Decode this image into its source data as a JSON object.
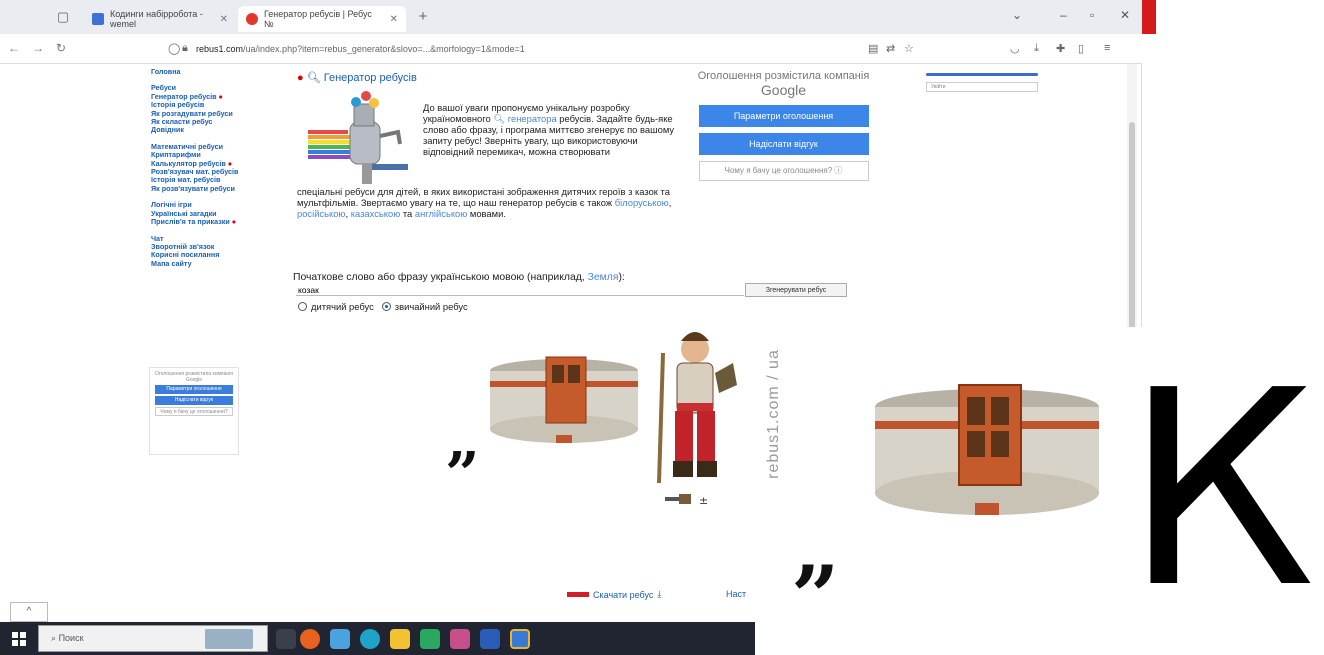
{
  "browser": {
    "tabs": [
      {
        "title": "Кодинги набірробота - wemel",
        "active": false
      },
      {
        "title": "Генератор ребусів | Ребус №",
        "active": true
      }
    ],
    "new_tab": "+",
    "url_domain": "rebus1.com",
    "url_rest": "/ua/index.php?item=rebus_generator&slovo=...&morfology=1&mode=1"
  },
  "sidebar": {
    "groups": [
      [
        "Головна"
      ],
      [
        "Ребуси",
        "Генератор ребусів",
        "Історія ребусів",
        "Як розгадувати ребуси",
        "Як скласти ребус",
        "Довідник"
      ],
      [
        "Математичні ребуси",
        "Криптарифми",
        "Калькулятор ребусів",
        "Розв'язувач мат. ребусів",
        "Історія мат. ребусів",
        "Як розв'язувати ребуси"
      ],
      [
        "Логічні ігри",
        "Українські загадки",
        "Прислів'я та приказки"
      ],
      [
        "Чат",
        "Зворотній зв'язок",
        "Корисні посилання",
        "Мапа сайту"
      ]
    ],
    "mini_ad": {
      "text": "Оголошення розмістила компанія Google",
      "btn1": "Параметри оголошення",
      "btn2": "Надіслати відгук",
      "why": "Чому я бачу це оголошення?"
    }
  },
  "main": {
    "title": "Генератор ребусів",
    "intro_part1": "До вашої уваги пропонуємо унікальну розробку україномовного",
    "intro_link": "генератора",
    "intro_part2": "ребусів. Задайте будь-яке слово або фразу, і програма миттєво згенерує по вашому запиту ребус! Зверніть увагу, що використовуючи відповідний перемикач, можна створювати",
    "intro_part3": "спеціальні ребуси для дітей, в яких використані зображення дитячих героїв з казок та мультфільмів. Звертаємо увагу на те, що наш генератор ребусів є також",
    "lang1": "білоруською",
    "lang2": "російською",
    "lang3": "казахською",
    "lang_and": "та",
    "lang4": "англійською",
    "intro_end": "мовами.",
    "prompt_text": "Початкове слово або фразу українською мовою (наприклад,",
    "prompt_example": "Земля",
    "prompt_close": "):",
    "input_value": "козак",
    "generate_button": "Згенерувати ребус",
    "radio_kids": "дитячий ребус",
    "radio_normal": "звичайний ребус",
    "download_link": "Скачати ребус",
    "next_link": "Наст"
  },
  "ad": {
    "header": "Оголошення розмістила компанія",
    "brand": "Google",
    "btn_settings": "Параметри оголошення",
    "btn_feedback": "Надіслати відгук",
    "why": "Чому я бачу це оголошення?"
  },
  "rightcol": {
    "pill": "Увійти"
  },
  "taskbar": {
    "search_placeholder": "Поиск"
  },
  "rebus": {
    "quote_mark": "”",
    "letter": "К",
    "watermark": "rebus1.com / ua"
  },
  "colors": {
    "link": "#1a5fb4",
    "ad_button": "#3b86e8",
    "taskbar": "#202531"
  }
}
